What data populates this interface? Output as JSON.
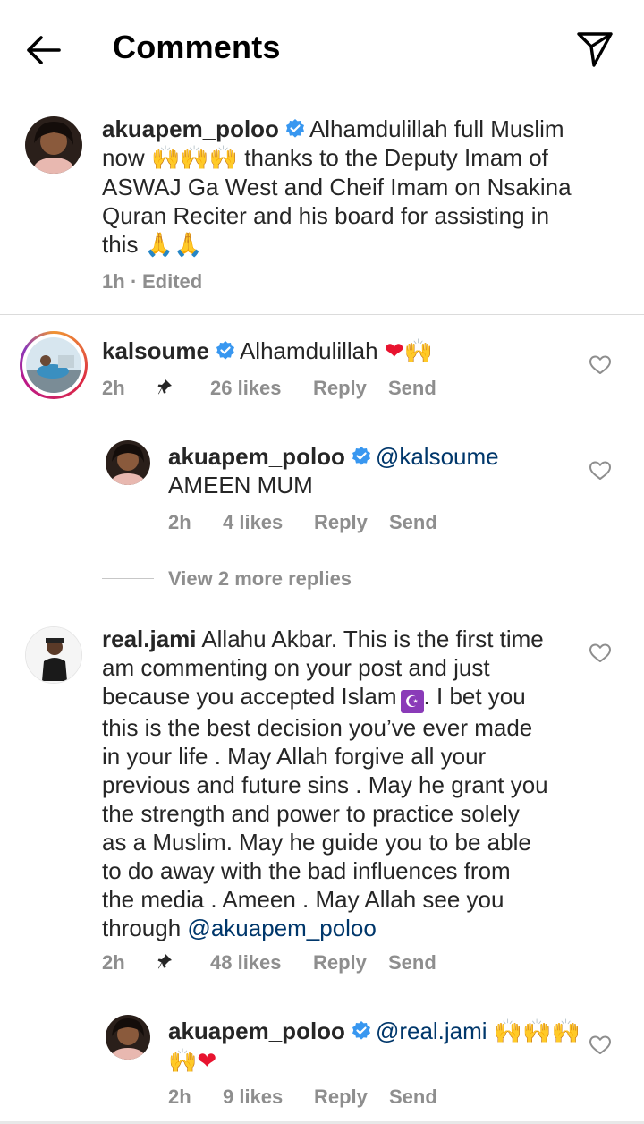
{
  "header": {
    "title": "Comments"
  },
  "caption": {
    "username": "akuapem_poloo",
    "lines": [
      "Alhamdulillah full Muslim",
      "thanks to the Deputy Imam of",
      "ASWAJ Ga West and Cheif Imam on Nsakina",
      "Quran Reciter and his board for assisting  in",
      "this"
    ],
    "line2_prefix": "now",
    "time": "1h",
    "separator": "·",
    "edited": "Edited"
  },
  "comments": [
    {
      "username": "kalsoume",
      "text": "Alhamdulillah",
      "time": "2h",
      "likes": "26 likes",
      "reply": "Reply",
      "send": "Send"
    },
    {
      "username": "akuapem_poloo",
      "mention": "@kalsoume",
      "text": "AMEEN MUM",
      "time": "2h",
      "likes": "4 likes",
      "reply": "Reply",
      "send": "Send"
    },
    {
      "view_more": "View 2 more replies"
    },
    {
      "username": "real.jami",
      "line1": "Allahu Akbar. This is the first time",
      "lines": [
        "am commenting on your post and just",
        "because you accepted Islam",
        "this is the best decision you’ve ever made",
        "in your life . May Allah forgive all your",
        "previous and future sins . May he grant you",
        "the strength and power to practice solely",
        "as a Muslim. May he guide you to be able",
        "to do away with the bad influences from",
        "the media . Ameen . May Allah see you",
        "through"
      ],
      "line3_suffix": ". I bet you",
      "mention": "@akuapem_poloo",
      "time": "2h",
      "likes": "48 likes",
      "reply": "Reply",
      "send": "Send"
    },
    {
      "username": "akuapem_poloo",
      "mention": "@real.jami",
      "time": "2h",
      "likes": "9 likes",
      "reply": "Reply",
      "send": "Send"
    }
  ],
  "icons": {
    "back": "arrow-left-icon",
    "share": "paper-plane-icon",
    "verified": "verified-badge-icon",
    "like": "heart-outline-icon",
    "pin": "pin-icon"
  },
  "colors": {
    "verified": "#3897f0",
    "mention": "#00376b",
    "secondary_text": "#8e8e8e",
    "divider": "#dbdbdb"
  }
}
